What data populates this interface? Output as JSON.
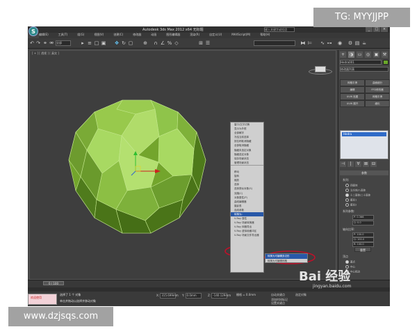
{
  "window": {
    "title": "Autodesk 3ds Max 2012 x64  无标题",
    "logo_glyph": "S",
    "search_placeholder": "键入关键字或短语",
    "controls": [
      "_",
      "□",
      "×"
    ]
  },
  "menubar": [
    "编辑(E)",
    "工具(T)",
    "组(G)",
    "视图(V)",
    "创建(C)",
    "修改器",
    "动画",
    "图形编辑器",
    "渲染(R)",
    "自定义(U)",
    "MAXScript(M)",
    "帮助(H)"
  ],
  "toolbar": {
    "selection_filter": "全部",
    "named_selection": "",
    "icons": [
      "undo-icon",
      "redo-icon",
      "link-icon",
      "unlink-icon",
      "select-icon",
      "select-name-icon",
      "rect-select-icon",
      "move-icon",
      "rotate-icon",
      "scale-icon",
      "snap-icon",
      "mirror-icon",
      "align-icon",
      "render-icon"
    ]
  },
  "viewport": {
    "label": "[ + ] [ 透视 ] [ 真实 ]"
  },
  "quad_menu": {
    "items": [
      "窗口/交叉切换",
      "显示为外框",
      "全部解冻",
      "冻结当前选择",
      "按名称取消隐藏",
      "全部取消隐藏",
      "隐藏未选定对象",
      "隐藏选定对象",
      "保存场景状态",
      "管理场景状态",
      "",
      "移动",
      "旋转",
      "缩放",
      "选择",
      "选择类似对象(S)",
      "克隆(C)",
      "对象属性(P)",
      "曲线编辑器",
      "摄影表",
      "连线参数",
      "转换为:",
      "V-Ray 属性",
      "V-Ray 场景转换器",
      "V-Ray 网格导出",
      "V-Ray 虚拟帧缓冲区",
      "V-Ray 场景文件导出器"
    ],
    "highlighted": "转换为:"
  },
  "submenu": {
    "items": [
      "转换为可编辑多边形",
      "转换为可编辑网格"
    ],
    "highlighted": "转换为可编辑多边形"
  },
  "command_panel": {
    "tabs": [
      "+",
      "◑",
      "▭",
      "◎",
      "▣",
      "⚒"
    ],
    "object_name": "Hedra001",
    "modifier_list": "修改器列表",
    "buttons": [
      "网格平滑",
      "曲面细分",
      "编辑",
      "FFD修改器",
      "UVW 贴图",
      "网格平滑",
      "UVW 展开",
      "细化"
    ],
    "stack_item": "Hedra",
    "stack_tools": [
      "⊣",
      "|",
      "∀",
      "⊠",
      "⊟"
    ],
    "params_title": "参数",
    "family_label": "系列:",
    "family_options": [
      "四面体",
      "立方体/八面体",
      "十二面体/二十面体",
      "星形1",
      "星形2"
    ],
    "family_selected": 2,
    "family_params_label": "系列参数:",
    "p_value": "P: 0.366",
    "q_value": "Q: 0.0",
    "axis_label": "轴向比率:",
    "axis_values": [
      "P: 100.0",
      "Q: 100.0",
      "R: 100.0"
    ],
    "reset_label": "重置",
    "vertex_label": "顶点",
    "vertex_options": [
      "基点",
      "中心",
      "中心和边"
    ]
  },
  "timeline": {
    "slider": "0 / 100",
    "ticks": [
      "0",
      "10",
      "20",
      "30",
      "40",
      "50",
      "60",
      "70",
      "80",
      "90",
      "100"
    ]
  },
  "status": {
    "maxscript": "欢迎使用",
    "line1": "选择了 1 个 对象",
    "line2": "单击并拖动以选择并移动对象",
    "x": "315.699mm",
    "y": "0.0mm",
    "z": "-140.129mm",
    "grid": "栅格 = 0.0mm",
    "auto_key": "自动关键点",
    "set_key": "设置关键点",
    "key_filter": "选定对象",
    "add_tag": "添加时间标记"
  },
  "overlays": {
    "tg": "TG: MYYJJPP",
    "site": "www.dzjsqs.com",
    "baidu": "Bai  经验",
    "baidu_url": "jingyan.baidu.com"
  },
  "colors": {
    "hedra_light": "#a6d65a",
    "hedra_mid": "#8cc23e",
    "hedra_dark": "#4e7a1a",
    "highlight": "#2858a8",
    "annotation": "#c0102a"
  }
}
